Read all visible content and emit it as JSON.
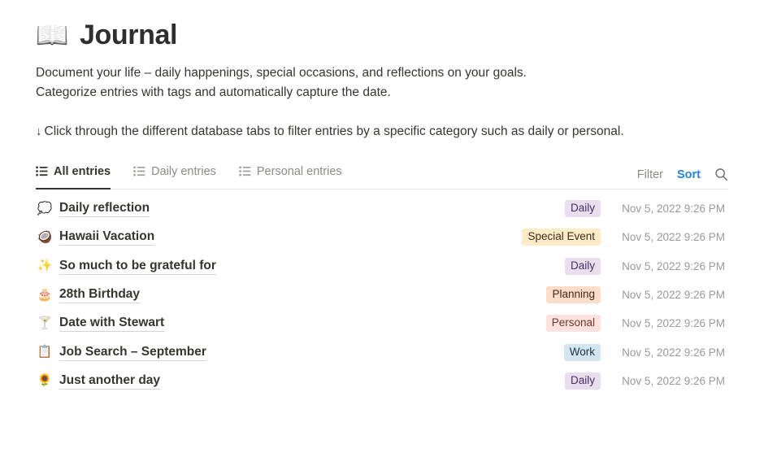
{
  "page": {
    "icon": "📖",
    "icon_name": "open-book-icon",
    "title": "Journal",
    "description_line_1": "Document your life – daily happenings, special occasions, and reflections on your goals.",
    "description_line_2": "Categorize entries with tags and automatically capture the date.",
    "callout_arrow": "↓",
    "callout_text": "Click through the different database tabs to filter entries by a specific category such as daily or personal."
  },
  "tabs": [
    {
      "label": "All entries",
      "active": true
    },
    {
      "label": "Daily entries",
      "active": false
    },
    {
      "label": "Personal entries",
      "active": false
    }
  ],
  "actions": {
    "filter_label": "Filter",
    "sort_label": "Sort",
    "sort_color": "#2383e2",
    "search_icon": "search-icon"
  },
  "entries": [
    {
      "icon": "💭",
      "icon_name": "thought-balloon-icon",
      "title": "Daily reflection",
      "tag": "Daily",
      "tag_bg": "#e8deee",
      "tag_fg": "#492f64",
      "date": "Nov 5, 2022 9:26 PM"
    },
    {
      "icon": "🥥",
      "icon_name": "coconut-icon",
      "title": "Hawaii Vacation",
      "tag": "Special Event",
      "tag_bg": "#fdecc8",
      "tag_fg": "#402c1b",
      "date": "Nov 5, 2022 9:26 PM"
    },
    {
      "icon": "✨",
      "icon_name": "sparkles-icon",
      "title": "So much to be grateful for",
      "tag": "Daily",
      "tag_bg": "#e8deee",
      "tag_fg": "#492f64",
      "date": "Nov 5, 2022 9:26 PM"
    },
    {
      "icon": "🎂",
      "icon_name": "birthday-cake-icon",
      "title": "28th Birthday",
      "tag": "Planning",
      "tag_bg": "#fadec9",
      "tag_fg": "#49290e",
      "date": "Nov 5, 2022 9:26 PM"
    },
    {
      "icon": "🍸",
      "icon_name": "cocktail-glass-icon",
      "title": "Date with Stewart",
      "tag": "Personal",
      "tag_bg": "#ffe2dd",
      "tag_fg": "#6e3630",
      "date": "Nov 5, 2022 9:26 PM"
    },
    {
      "icon": "📋",
      "icon_name": "clipboard-icon",
      "title": "Job Search – September",
      "tag": "Work",
      "tag_bg": "#d3e5ef",
      "tag_fg": "#183347",
      "date": "Nov 5, 2022 9:26 PM"
    },
    {
      "icon": "🌻",
      "icon_name": "sunflower-icon",
      "title": "Just another day",
      "tag": "Daily",
      "tag_bg": "#e8deee",
      "tag_fg": "#492f64",
      "date": "Nov 5, 2022 9:26 PM"
    }
  ]
}
